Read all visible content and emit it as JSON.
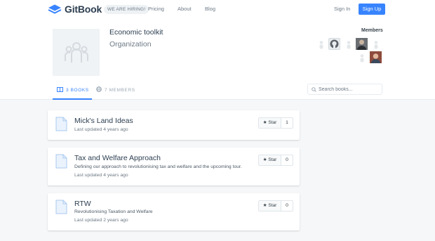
{
  "nav": {
    "brand": "GitBook",
    "hiring": "WE ARE HIRING!",
    "links": [
      "Pricing",
      "About",
      "Blog"
    ],
    "signin": "Sign In",
    "signup": "Sign Up"
  },
  "org": {
    "name": "Economic toolkit",
    "type": "Organization"
  },
  "members": {
    "title": "Members"
  },
  "tabs": {
    "books": "3 BOOKS",
    "members": "7 MEMBERS"
  },
  "search": {
    "placeholder": "Search books..."
  },
  "books": [
    {
      "title": "Mick's Land Ideas",
      "description": "",
      "updated": "Last updated 4 years ago",
      "star_label": "Star",
      "stars": "1"
    },
    {
      "title": "Tax and Welfare Approach",
      "description": "Defining our approach to revolutionising tax and welfare and the upcoming tour.",
      "updated": "Last updated 4 years ago",
      "star_label": "Star",
      "stars": "0"
    },
    {
      "title": "RTW",
      "description": "Revolutionising Taxation and Welfare",
      "updated": "Last updated 2 years ago",
      "star_label": "Star",
      "stars": "0"
    }
  ],
  "colors": {
    "accent": "#3884ff",
    "text": "#364149",
    "muted": "#6d7a86"
  }
}
